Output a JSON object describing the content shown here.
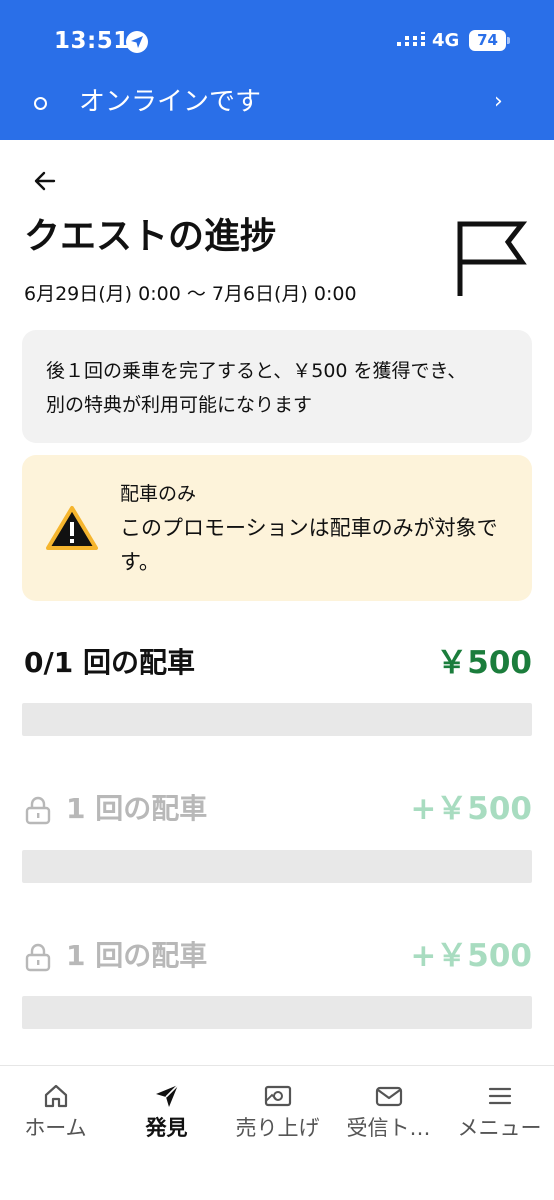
{
  "status_bar": {
    "time": "13:51",
    "network": "4G",
    "battery": "74"
  },
  "online_banner": {
    "label": "オンラインです",
    "chevron": "›"
  },
  "header": {
    "title": "クエストの進捗",
    "dates": "6月29日(月) 0:00 〜 7月6日(月) 0:00"
  },
  "info_card": {
    "text": "後１回の乗車を完了すると、￥500 を獲得でき、別の特典が利用可能になります"
  },
  "warning_card": {
    "title": "配車のみ",
    "body": "このプロモーションは配車のみが対象です。"
  },
  "quests": [
    {
      "label": "0/1 回の配車",
      "amount": "￥500",
      "state": "active",
      "progress": 0
    },
    {
      "label": "1 回の配車",
      "amount": "+￥500",
      "state": "locked",
      "progress": 0
    },
    {
      "label": "1 回の配車",
      "amount": "+￥500",
      "state": "locked",
      "progress": 0
    }
  ],
  "bottom_nav": [
    {
      "label": "ホーム",
      "icon": "home-icon",
      "active": false
    },
    {
      "label": "発見",
      "icon": "discover-icon",
      "active": true
    },
    {
      "label": "売り上げ",
      "icon": "earnings-icon",
      "active": false
    },
    {
      "label": "受信ト…",
      "icon": "inbox-icon",
      "active": false
    },
    {
      "label": "メニュー",
      "icon": "menu-icon",
      "active": false
    }
  ],
  "colors": {
    "topbar": "#2a6fe8",
    "amount_active": "#1b7d3c",
    "amount_locked": "#a8dcc0",
    "warning_bg": "#fdf3da",
    "warning_icon": "#f5b52e"
  }
}
